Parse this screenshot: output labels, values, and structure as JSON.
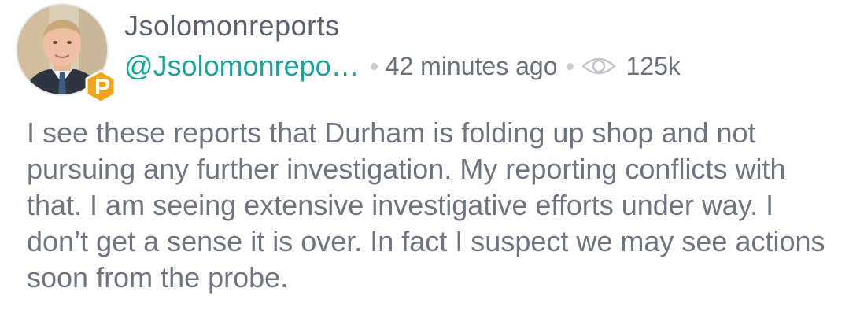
{
  "post": {
    "display_name": "Jsolomonreports",
    "handle": "@Jsolomonrepo…",
    "timestamp": "42 minutes ago",
    "view_count": "125k",
    "body": "I see these reports that Durham is folding up shop and not pursuing any further investigation. My reporting conflicts with that. I am seeing extensive investigative efforts under way. I don’t get a sense it is over. In fact I suspect we may see actions soon from the probe."
  },
  "icons": {
    "badge": "parler-badge-icon",
    "views": "eye-icon"
  },
  "colors": {
    "handle": "#1aa39b",
    "badge": "#f2a51a",
    "text": "#6e7480"
  }
}
